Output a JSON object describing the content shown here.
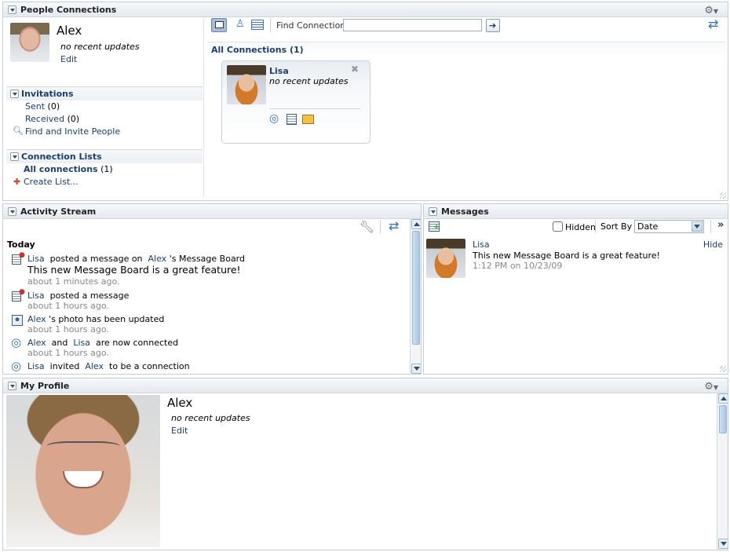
{
  "people_connections": {
    "title": "People Connections",
    "user": {
      "name": "Alex",
      "status": "no recent updates",
      "edit_label": "Edit"
    },
    "invitations": {
      "title": "Invitations",
      "sent_label": "Sent",
      "sent_count": "(0)",
      "received_label": "Received",
      "received_count": "(0)",
      "find_invite_label": "Find and Invite People"
    },
    "connection_lists": {
      "title": "Connection Lists",
      "all_label": "All connections",
      "all_count": "(1)",
      "create_label": "Create List..."
    },
    "toolbar": {
      "find_label": "Find Connection",
      "find_value": ""
    },
    "all_connections_title": "All Connections (1)",
    "card": {
      "name": "Lisa",
      "status": "no recent updates"
    }
  },
  "activity_stream": {
    "title": "Activity Stream",
    "group_label": "Today",
    "items": [
      {
        "actor": "Lisa",
        "action": "posted a message on",
        "target": "Alex",
        "target_suffix": "'s Message Board",
        "body": "This new Message Board is a great feature!",
        "time": "about 1 minutes ago."
      },
      {
        "actor": "Lisa",
        "action": "posted a message",
        "time": "about 1 hours ago."
      },
      {
        "actor": "Alex",
        "action": "'s photo has been updated",
        "time": "about 1 hours ago."
      },
      {
        "actor": "Alex",
        "action": "and",
        "target": "Lisa",
        "target_suffix": "are now connected",
        "time": "about 1 hours ago."
      },
      {
        "actor": "Lisa",
        "action": "invited",
        "target": "Alex",
        "target_suffix": "to be a connection"
      }
    ]
  },
  "messages": {
    "title": "Messages",
    "hidden_label": "Hidden",
    "sort_label": "Sort By",
    "sort_value": "Date",
    "item": {
      "author": "Lisa",
      "hide_label": "Hide",
      "body": "This new Message Board is a great feature!",
      "time": "1:12 PM on 10/23/09"
    }
  },
  "my_profile": {
    "title": "My Profile",
    "name": "Alex",
    "status": "no recent updates",
    "edit_label": "Edit"
  }
}
